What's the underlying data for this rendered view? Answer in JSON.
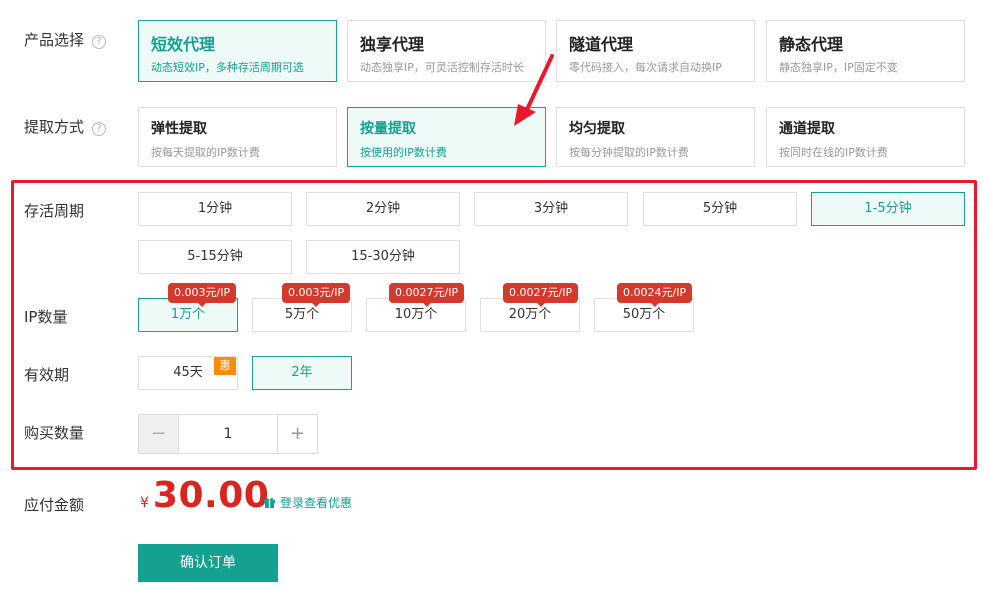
{
  "labels": {
    "product": "产品选择",
    "extract": "提取方式",
    "lifetime": "存活周期",
    "ip_count": "IP数量",
    "validity": "有效期",
    "quantity": "购买数量",
    "amount": "应付金额"
  },
  "help_icon": "?",
  "products": [
    {
      "title": "短效代理",
      "sub": "动态短效IP，多种存活周期可选"
    },
    {
      "title": "独享代理",
      "sub": "动态独享IP，可灵活控制存活时长"
    },
    {
      "title": "隧道代理",
      "sub": "零代码接入，每次请求自动换IP"
    },
    {
      "title": "静态代理",
      "sub": "静态独享IP，IP固定不变"
    }
  ],
  "extract_methods": [
    {
      "title": "弹性提取",
      "sub": "按每天提取的IP数计费"
    },
    {
      "title": "按量提取",
      "sub": "按使用的IP数计费"
    },
    {
      "title": "均匀提取",
      "sub": "按每分钟提取的IP数计费"
    },
    {
      "title": "通道提取",
      "sub": "按同时在线的IP数计费"
    }
  ],
  "lifetimes": [
    "1分钟",
    "2分钟",
    "3分钟",
    "5分钟",
    "1-5分钟",
    "5-15分钟",
    "15-30分钟"
  ],
  "ip_counts": [
    {
      "label": "1万个",
      "tag": "0.003元/IP"
    },
    {
      "label": "5万个",
      "tag": "0.003元/IP"
    },
    {
      "label": "10万个",
      "tag": "0.0027元/IP"
    },
    {
      "label": "20万个",
      "tag": "0.0027元/IP"
    },
    {
      "label": "50万个",
      "tag": "0.0024元/IP"
    }
  ],
  "validity_options": [
    {
      "label": "45天",
      "badge": "惠"
    },
    {
      "label": "2年"
    }
  ],
  "stepper": {
    "minus": "−",
    "value": "1",
    "plus": "+"
  },
  "price": {
    "currency": "¥",
    "value": "30.00"
  },
  "login_promo": "登录查看优惠",
  "confirm_button": "确认订单",
  "colors": {
    "accent": "#14a190",
    "price": "#d9251d",
    "highlight_box": "#e8192c",
    "tag": "#d43a2c",
    "badge": "#ff8c00"
  },
  "selected": {
    "product": 0,
    "extract": 1,
    "lifetime": 4,
    "ip_count": 0,
    "validity": 1
  }
}
